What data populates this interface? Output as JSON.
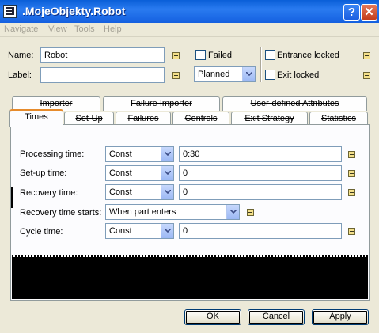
{
  "window": {
    "title": ".MojeObjekty.Robot",
    "help_label": "?",
    "close_label": "✕"
  },
  "menu": [
    "Navigate",
    "View",
    "Tools",
    "Help"
  ],
  "header": {
    "name_label": "Name:",
    "name_value": "Robot",
    "label_label": "Label:",
    "label_value": "",
    "failed_label": "Failed",
    "failed_checked": false,
    "status_value": "Planned",
    "entrance_locked_label": "Entrance locked",
    "entrance_locked_checked": false,
    "exit_locked_label": "Exit locked",
    "exit_locked_checked": false
  },
  "tabs_back": [
    "Importer",
    "Failure Importer",
    "User-defined Attributes"
  ],
  "tabs_front": [
    "Times",
    "Set-Up",
    "Failures",
    "Controls",
    "Exit Strategy",
    "Statistics"
  ],
  "active_tab": "Times",
  "times": {
    "processing": {
      "label": "Processing time:",
      "type": "Const",
      "value": "0:30"
    },
    "setup": {
      "label": "Set-up time:",
      "type": "Const",
      "value": "0"
    },
    "recovery": {
      "label": "Recovery time:",
      "type": "Const",
      "value": "0"
    },
    "recovery_starts": {
      "label": "Recovery time starts:",
      "value": "When part enters"
    },
    "cycle": {
      "label": "Cycle time:",
      "type": "Const",
      "value": "0"
    }
  },
  "buttons": {
    "ok": "OK",
    "cancel": "Cancel",
    "apply": "Apply"
  },
  "colors": {
    "titlebar": "#0a5fd8",
    "dialog_bg": "#ece9d8",
    "active_tab_accent": "#e68b2c"
  }
}
